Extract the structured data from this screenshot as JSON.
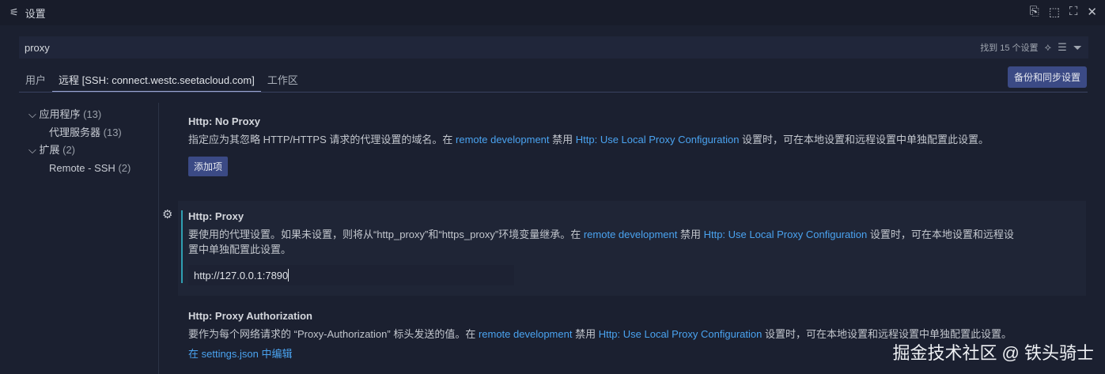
{
  "title": "设置",
  "search": {
    "value": "proxy",
    "result_count": "找到 15 个设置"
  },
  "tabs": [
    "用户",
    "远程 [SSH: connect.westc.seetacloud.com]",
    "工作区"
  ],
  "sync_button": "备份和同步设置",
  "tree": [
    {
      "label": "应用程序",
      "count": "(13)"
    },
    {
      "label": "代理服务器",
      "count": "(13)"
    },
    {
      "label": "扩展",
      "count": "(2)"
    },
    {
      "label": "Remote - SSH",
      "count": "(2)"
    }
  ],
  "settings": [
    {
      "title": "Http: No Proxy",
      "desc_a": "指定应为其忽略 HTTP/HTTPS 请求的代理设置的域名。在 ",
      "link1": "remote development",
      "mid": " 禁用 ",
      "link2": "Http: Use Local Proxy Configuration",
      "desc_b": " 设置时，可在本地设置和远程设置中单独配置此设置。",
      "button": "添加项"
    },
    {
      "title": "Http: Proxy",
      "desc_a": "要使用的代理设置。如果未设置，则将从“http_proxy”和“https_proxy”环境变量继承。在 ",
      "link1": "remote development",
      "mid": " 禁用 ",
      "link2": "Http: Use Local Proxy Configuration",
      "desc_b": " 设置时，可在本地设置和远程设置中单独配置此设置。",
      "value": "http://127.0.0.1:7890"
    },
    {
      "title": "Http: Proxy Authorization",
      "desc_a": "要作为每个网络请求的 “Proxy-Authorization” 标头发送的值。在 ",
      "link1": "remote development",
      "mid": " 禁用 ",
      "link2": "Http: Use Local Proxy Configuration",
      "desc_b": " 设置时，可在本地设置和远程设置中单独配置此设置。",
      "edit_link": "在 settings.json 中编辑"
    }
  ],
  "watermark": "掘金技术社区 @ 铁头骑士"
}
